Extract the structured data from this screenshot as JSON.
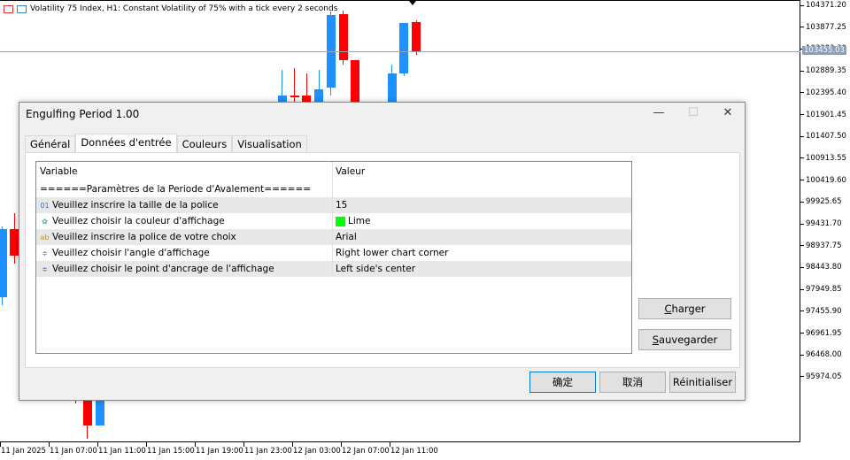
{
  "chart": {
    "title": "Volatility 75 Index, H1:  Constant Volatility of 75% with a tick every 2 seconds",
    "current_price": "103455.03",
    "y_ticks": [
      "104371.20",
      "103877.25",
      "103383.30",
      "102889.35",
      "102395.40",
      "101901.45",
      "101407.50",
      "100913.55",
      "100419.60",
      "99925.65",
      "99431.70",
      "98937.75",
      "98443.80",
      "97949.85",
      "97455.90",
      "96961.95",
      "96468.00",
      "95974.05"
    ],
    "x_ticks": [
      "11 Jan 2025",
      "11 Jan 07:00",
      "11 Jan 11:00",
      "11 Jan 15:00",
      "11 Jan 19:00",
      "11 Jan 23:00",
      "12 Jan 03:00",
      "12 Jan 07:00",
      "12 Jan 11:00"
    ],
    "bull_color": "#1e90ff",
    "bear_color": "#ff0000",
    "candles": [
      {
        "t": "2025-01-11 00:00",
        "o": 98456,
        "h": 99900,
        "l": 98300,
        "c": 99840
      },
      {
        "t": "2025-01-11 01:00",
        "o": 99840,
        "h": 100164,
        "l": 99139,
        "c": 99301
      },
      {
        "t": "2025-01-11 06:00",
        "o": 96400,
        "h": 96400,
        "l": 96300,
        "c": 96350
      },
      {
        "t": "2025-01-11 07:00",
        "o": 96352,
        "h": 96352,
        "l": 95579,
        "c": 95849
      },
      {
        "t": "2025-01-11 08:00",
        "o": 95849,
        "h": 96352,
        "l": 95849,
        "c": 96352
      },
      {
        "t": "2025-01-11 23:00",
        "o": 102300,
        "h": 103077,
        "l": 102200,
        "c": 102555
      },
      {
        "t": "2025-01-12 00:00",
        "o": 102555,
        "h": 103113,
        "l": 102300,
        "c": 102537
      },
      {
        "t": "2025-01-12 01:00",
        "o": 102555,
        "h": 103005,
        "l": 102200,
        "c": 102300
      },
      {
        "t": "2025-01-12 02:00",
        "o": 102300,
        "h": 103077,
        "l": 102200,
        "c": 102681
      },
      {
        "t": "2025-01-12 03:00",
        "o": 102717,
        "h": 104263,
        "l": 102555,
        "c": 104191
      },
      {
        "t": "2025-01-12 04:00",
        "o": 104209,
        "h": 104281,
        "l": 103185,
        "c": 103274
      },
      {
        "t": "2025-01-12 05:00",
        "o": 103274,
        "h": 103274,
        "l": 102000,
        "c": 102100
      },
      {
        "t": "2025-01-12 08:00",
        "o": 102300,
        "h": 103185,
        "l": 102200,
        "c": 103005
      },
      {
        "t": "2025-01-12 09:00",
        "o": 103005,
        "h": 104030,
        "l": 102950,
        "c": 104030
      },
      {
        "t": "2025-01-12 10:00",
        "o": 104048,
        "h": 104084,
        "l": 103382,
        "c": 103454
      }
    ]
  },
  "dialog": {
    "title": "Engulfing Period 1.00",
    "tabs": [
      "Général",
      "Données d'entrée",
      "Couleurs",
      "Visualisation"
    ],
    "active_tab": 1,
    "headers": {
      "variable": "Variable",
      "value": "Valeur"
    },
    "rows": [
      {
        "icon": "",
        "variable": "======Paramètres de la Periode d'Avalement======",
        "value": ""
      },
      {
        "icon": "01",
        "icon_color": "#2a6fb8",
        "variable": "Veuillez inscrire la taille de la police",
        "value": "15"
      },
      {
        "icon": "✿",
        "icon_color": "#5a9",
        "variable": "Veuillez choisir la couleur d'affichage",
        "value": "Lime",
        "swatch": "#00ff00"
      },
      {
        "icon": "ab",
        "icon_color": "#c89020",
        "variable": "Veuillez inscrire la police de votre choix",
        "value": "Arial"
      },
      {
        "icon": "≑",
        "icon_color": "#3a6fb8",
        "variable": "Veuillez choisir l'angle d'affichage",
        "value": "Right lower chart corner"
      },
      {
        "icon": "≑",
        "icon_color": "#3a6fb8",
        "variable": "Veuillez choisir le point d'ancrage de l'affichage",
        "value": "Left side's center"
      }
    ],
    "load": {
      "mnemonic": "C",
      "rest": "harger"
    },
    "save": {
      "mnemonic": "S",
      "rest": "auvegarder"
    },
    "ok": "确定",
    "cancel": "取消",
    "reset": "Réinitialiser"
  }
}
